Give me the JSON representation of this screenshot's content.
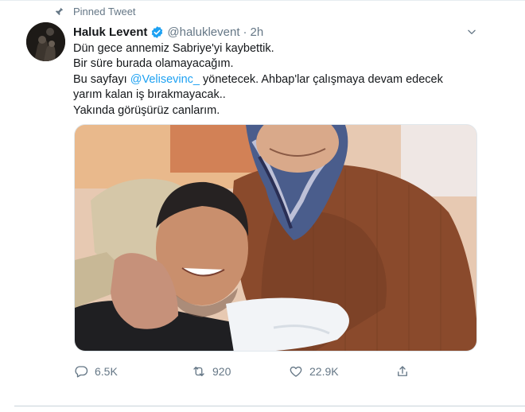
{
  "pinned": {
    "label": "Pinned Tweet"
  },
  "author": {
    "name": "Haluk Levent",
    "handle": "@haluklevent",
    "separator": "·",
    "time": "2h"
  },
  "tweet": {
    "line1": "Dün gece annemiz Sabriye'yi kaybettik.",
    "line2": "Bir süre burada olamayacağım.",
    "line3_before": "Bu sayfayı ",
    "line3_mention": "@Velisevinc_",
    "line3_after": " yönetecek. Ahbap'lar çalışmaya devam edecek",
    "line4": "yarım kalan iş bırakmayacak..",
    "line5": "Yakında görüşürüz canlarım."
  },
  "actions": {
    "replies": "6.5K",
    "retweets": "920",
    "likes": "22.9K"
  },
  "icons": {
    "pin": "pin-icon",
    "verified": "verified-badge-icon",
    "caret": "chevron-down-icon",
    "reply": "reply-icon",
    "retweet": "retweet-icon",
    "like": "heart-icon",
    "share": "share-icon"
  },
  "colors": {
    "accent": "#1da1f2",
    "secondary_text": "#657786",
    "primary_text": "#14171a"
  }
}
